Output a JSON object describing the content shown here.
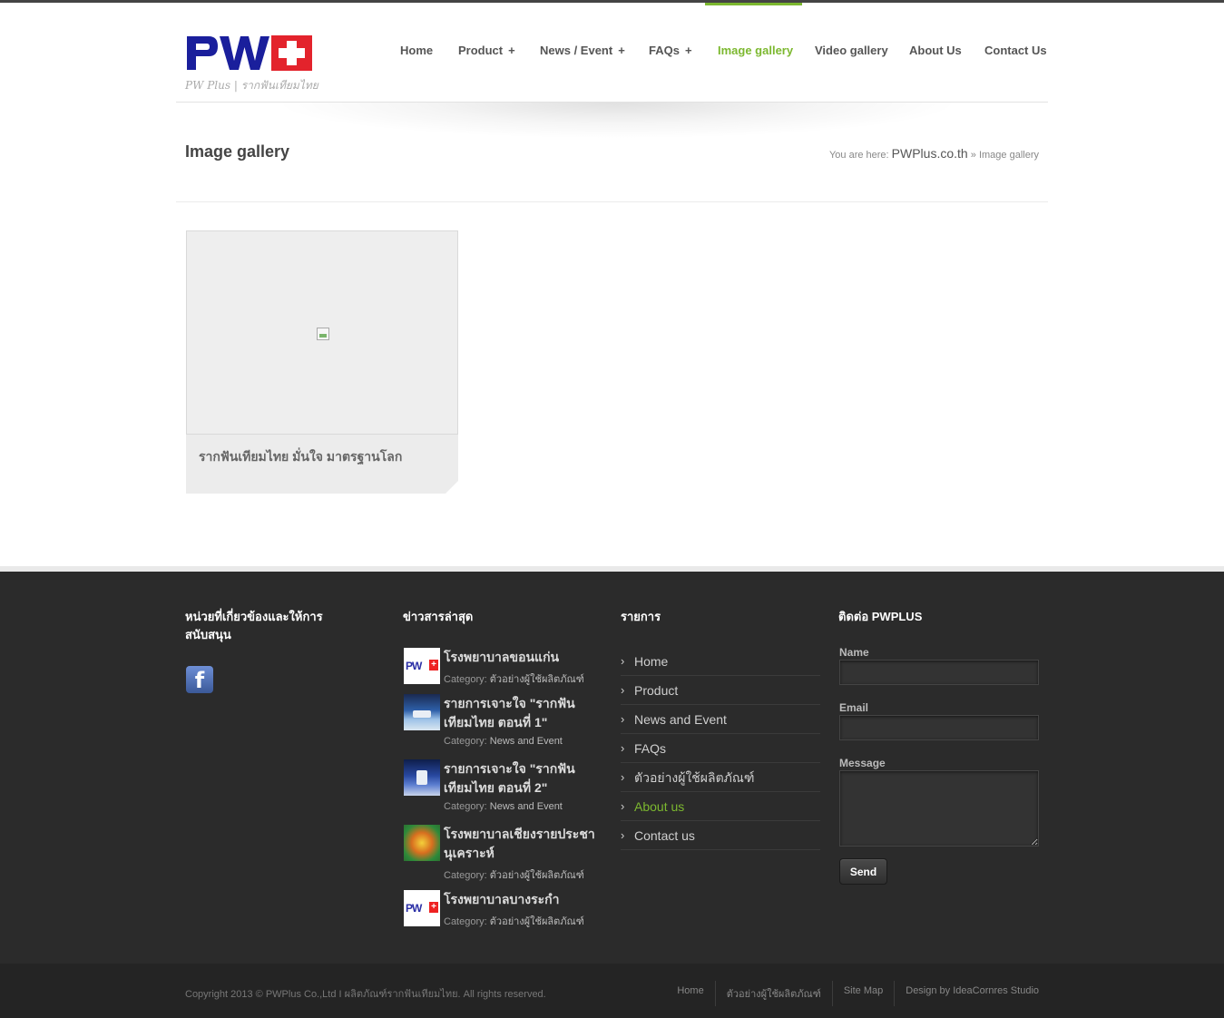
{
  "brand": {
    "logo_text": "PW",
    "tagline": "PW Plus | รากฟันเทียมไทย",
    "colors": {
      "accent": "#7cb82f",
      "logo_blue": "#1a1f9c",
      "logo_red": "#e3232c"
    }
  },
  "nav": {
    "items": [
      {
        "label": "Home",
        "has_sub": false
      },
      {
        "label": "Product",
        "has_sub": true
      },
      {
        "label": "News / Event",
        "has_sub": true
      },
      {
        "label": "FAQs",
        "has_sub": true
      },
      {
        "label": "Image gallery",
        "has_sub": false,
        "active": true
      },
      {
        "label": "Video gallery",
        "has_sub": false
      },
      {
        "label": "About Us",
        "has_sub": false
      },
      {
        "label": "Contact Us",
        "has_sub": false
      }
    ],
    "sub_indicator": "+"
  },
  "page": {
    "title": "Image gallery",
    "breadcrumb_prefix": "You are here:",
    "breadcrumb_site": "PWPlus.co.th",
    "breadcrumb_sep": "»",
    "breadcrumb_current": "Image gallery"
  },
  "gallery": {
    "items": [
      {
        "caption": "รากฟันเทียมไทย มั่นใจ มาตรฐานโลก"
      }
    ]
  },
  "footer": {
    "col1": {
      "title": "หน่วยที่เกี่ยวข้องและให้การสนับสนุน",
      "facebook_icon": "facebook-icon"
    },
    "col2": {
      "title": "ข่าวสารล่าสุด",
      "category_label": "Category:",
      "items": [
        {
          "title": "โรงพยาบาลขอนแก่น",
          "category": "ตัวอย่างผู้ใช้ผลิตภัณฑ์"
        },
        {
          "title": "รายการเจาะใจ \"รากฟันเทียมไทย ตอนที่ 1\"",
          "category": "News and Event"
        },
        {
          "title": "รายการเจาะใจ \"รากฟันเทียมไทย ตอนที่ 2\"",
          "category": "News and Event"
        },
        {
          "title": "โรงพยาบาลเชียงรายประชานุเคราะห์",
          "category": "ตัวอย่างผู้ใช้ผลิตภัณฑ์"
        },
        {
          "title": "โรงพยาบาลบางระกำ",
          "category": "ตัวอย่างผู้ใช้ผลิตภัณฑ์"
        }
      ]
    },
    "col3": {
      "title": "รายการ",
      "items": [
        {
          "label": "Home"
        },
        {
          "label": "Product"
        },
        {
          "label": "News and Event"
        },
        {
          "label": "FAQs"
        },
        {
          "label": "ตัวอย่างผู้ใช้ผลิตภัณฑ์"
        },
        {
          "label": "About us",
          "active": true
        },
        {
          "label": "Contact us"
        }
      ]
    },
    "col4": {
      "title": "ติดต่อ PWPLUS",
      "name_label": "Name",
      "name_value": "",
      "email_label": "Email",
      "email_value": "",
      "message_label": "Message",
      "message_value": "",
      "send_label": "Send"
    }
  },
  "bottom": {
    "copyright": "Copyright 2013 © PWPlus Co.,Ltd I ผลิตภัณฑ์รากฟันเทียมไทย. All rights reserved.",
    "links": [
      "Home",
      "ตัวอย่างผู้ใช้ผลิตภัณฑ์",
      "Site Map",
      "Design by IdeaCornres Studio"
    ]
  }
}
